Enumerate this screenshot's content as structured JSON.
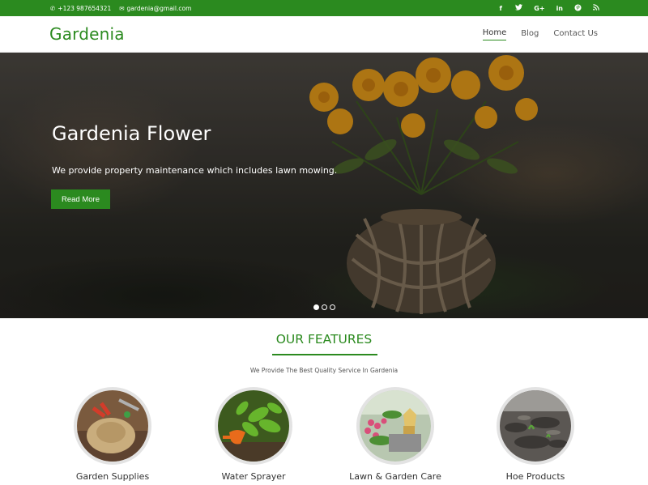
{
  "topbar": {
    "phone": "+123 987654321",
    "email": "gardenia@gmail.com",
    "social": [
      {
        "icon": "facebook-icon",
        "glyph": "f"
      },
      {
        "icon": "twitter-icon",
        "glyph": "t"
      },
      {
        "icon": "google-plus-icon",
        "glyph": "G+"
      },
      {
        "icon": "linkedin-icon",
        "glyph": "in"
      },
      {
        "icon": "pinterest-icon",
        "glyph": "p"
      },
      {
        "icon": "rss-icon",
        "glyph": "◢"
      }
    ]
  },
  "header": {
    "logo": "Gardenia",
    "nav": [
      {
        "label": "Home",
        "active": true
      },
      {
        "label": "Blog",
        "active": false
      },
      {
        "label": "Contact Us",
        "active": false
      }
    ]
  },
  "hero": {
    "title": "Gardenia Flower",
    "subtitle": "We provide property maintenance which includes lawn mowing.",
    "button": "Read More",
    "slides": 3,
    "active_slide": 1
  },
  "features": {
    "title": "OUR FEATURES",
    "subtitle": "We Provide The Best Quality Service In Gardenia",
    "items": [
      {
        "label": "Garden Supplies"
      },
      {
        "label": "Water Sprayer"
      },
      {
        "label": "Lawn & Garden Care"
      },
      {
        "label": "Hoe Products"
      }
    ]
  },
  "colors": {
    "brand_green": "#2b8a1f"
  }
}
